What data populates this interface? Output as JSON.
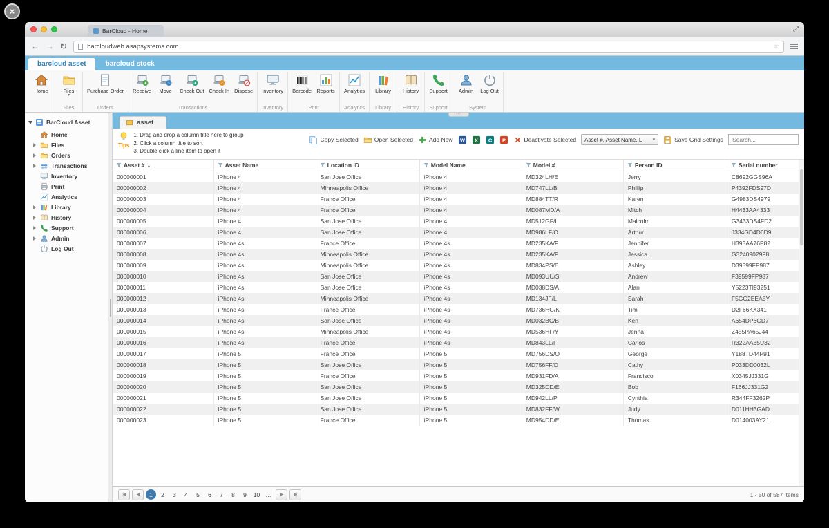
{
  "browser": {
    "tab_title": "BarCloud - Home",
    "url": "barcloudweb.asapsystems.com"
  },
  "app_tabs": [
    {
      "label": "barcloud asset",
      "active": true
    },
    {
      "label": "barcloud stock",
      "active": false
    }
  ],
  "ribbon_groups": [
    {
      "caption": "",
      "buttons": [
        {
          "label": "Home",
          "icon": "home-icon"
        }
      ]
    },
    {
      "caption": "Files",
      "buttons": [
        {
          "label": "Files",
          "icon": "folder-icon",
          "caret": true
        }
      ]
    },
    {
      "caption": "Orders",
      "buttons": [
        {
          "label": "Purchase Order",
          "icon": "purchase-order-icon"
        }
      ]
    },
    {
      "caption": "Transactions",
      "buttons": [
        {
          "label": "Receive",
          "icon": "laptop-receive-icon"
        },
        {
          "label": "Move",
          "icon": "laptop-move-icon"
        },
        {
          "label": "Check Out",
          "icon": "laptop-checkout-icon"
        },
        {
          "label": "Check In",
          "icon": "laptop-checkin-icon"
        },
        {
          "label": "Dispose",
          "icon": "laptop-dispose-icon"
        }
      ]
    },
    {
      "caption": "Inventory",
      "buttons": [
        {
          "label": "Inventory",
          "icon": "monitor-icon"
        }
      ]
    },
    {
      "caption": "Print",
      "buttons": [
        {
          "label": "Barcode",
          "icon": "barcode-icon"
        },
        {
          "label": "Reports",
          "icon": "report-chart-icon"
        }
      ]
    },
    {
      "caption": "Analytics",
      "buttons": [
        {
          "label": "Analytics",
          "icon": "analytics-icon"
        }
      ]
    },
    {
      "caption": "Library",
      "buttons": [
        {
          "label": "Library",
          "icon": "library-icon"
        }
      ]
    },
    {
      "caption": "History",
      "buttons": [
        {
          "label": "History",
          "icon": "history-icon"
        }
      ]
    },
    {
      "caption": "Support",
      "buttons": [
        {
          "label": "Support",
          "icon": "support-icon"
        }
      ]
    },
    {
      "caption": "System",
      "buttons": [
        {
          "label": "Admin",
          "icon": "admin-icon"
        },
        {
          "label": "Log Out",
          "icon": "logout-icon"
        }
      ]
    }
  ],
  "sidebar": {
    "root": "BarCloud Asset",
    "items": [
      {
        "label": "Home",
        "icon": "home-icon",
        "expandable": false
      },
      {
        "label": "Files",
        "icon": "folder-icon",
        "expandable": true
      },
      {
        "label": "Orders",
        "icon": "folder-icon",
        "expandable": true
      },
      {
        "label": "Transactions",
        "icon": "transactions-icon",
        "expandable": true
      },
      {
        "label": "Inventory",
        "icon": "monitor-icon",
        "expandable": false
      },
      {
        "label": "Print",
        "icon": "print-icon",
        "expandable": false
      },
      {
        "label": "Analytics",
        "icon": "analytics-icon",
        "expandable": false
      },
      {
        "label": "Library",
        "icon": "library-icon",
        "expandable": true
      },
      {
        "label": "History",
        "icon": "history-icon",
        "expandable": true
      },
      {
        "label": "Support",
        "icon": "support-icon",
        "expandable": true
      },
      {
        "label": "Admin",
        "icon": "admin-icon",
        "expandable": true
      },
      {
        "label": "Log Out",
        "icon": "logout-icon",
        "expandable": false
      }
    ]
  },
  "content": {
    "tab_label": "asset",
    "tips": {
      "label": "Tips",
      "lines": [
        "1. Drag and drop a column title here to group",
        "2. Click a column title to sort",
        "3. Double click a line item to open it"
      ]
    },
    "actions": {
      "copy": "Copy Selected",
      "open": "Open Selected",
      "add": "Add New",
      "deactivate": "Deactivate Selected",
      "column_select": "Asset #, Asset Name, L",
      "save_grid": "Save Grid Settings",
      "search_placeholder": "Search..."
    },
    "grid": {
      "columns": [
        {
          "label": "Asset #",
          "sorted": "asc"
        },
        {
          "label": "Asset Name"
        },
        {
          "label": "Location ID"
        },
        {
          "label": "Model Name"
        },
        {
          "label": "Model #"
        },
        {
          "label": "Person ID"
        },
        {
          "label": "Serial number"
        }
      ],
      "rows": [
        [
          "000000001",
          "iPhone 4",
          "San Jose Office",
          "iPhone 4",
          "MD324LH/E",
          "Jerry",
          "C8692GGS96A"
        ],
        [
          "000000002",
          "iPhone 4",
          "Minneapolis Office",
          "iPhone 4",
          "MD747LL/B",
          "Phillip",
          "P4392FDS97D"
        ],
        [
          "000000003",
          "iPhone 4",
          "France Office",
          "iPhone 4",
          "MD884TT/R",
          "Karen",
          "G4983DS4979"
        ],
        [
          "000000004",
          "iPhone 4",
          "France Office",
          "iPhone 4",
          "MD087MD/A",
          "Mitch",
          "H4433AA4333"
        ],
        [
          "000000005",
          "iPhone 4",
          "San Jose Office",
          "iPhone 4",
          "MD512GF/I",
          "Malcolm",
          "G3433DS4FD2"
        ],
        [
          "000000006",
          "iPhone 4",
          "San Jose Office",
          "iPhone 4",
          "MD986LF/O",
          "Arthur",
          "J334GD4D6D9"
        ],
        [
          "000000007",
          "iPhone 4s",
          "France Office",
          "iPhone 4s",
          "MD235KA/P",
          "Jennifer",
          "H395AA76P82"
        ],
        [
          "000000008",
          "iPhone 4s",
          "Minneapolis Office",
          "iPhone 4s",
          "MD235KA/P",
          "Jessica",
          "G32409029F8"
        ],
        [
          "000000009",
          "iPhone 4s",
          "Minneapolis Office",
          "iPhone 4s",
          "MD834PS/E",
          "Ashley",
          "D39599FP987"
        ],
        [
          "000000010",
          "iPhone 4s",
          "San Jose Office",
          "iPhone 4s",
          "MD093UU/S",
          "Andrew",
          "F39599FP987"
        ],
        [
          "000000011",
          "iPhone 4s",
          "San Jose Office",
          "iPhone 4s",
          "MD038DS/A",
          "Alan",
          "Y5223TI93251"
        ],
        [
          "000000012",
          "iPhone 4s",
          "Minneapolis Office",
          "iPhone 4s",
          "MD134JF/L",
          "Sarah",
          "F5GG2EEA5Y"
        ],
        [
          "000000013",
          "iPhone 4s",
          "France Office",
          "iPhone 4s",
          "MD736HG/K",
          "Tim",
          "D2F66KX341"
        ],
        [
          "000000014",
          "iPhone 4s",
          "San Jose Office",
          "iPhone 4s",
          "MD032BC/B",
          "Ken",
          "A654DP6GD7"
        ],
        [
          "000000015",
          "iPhone 4s",
          "Minneapolis Office",
          "iPhone 4s",
          "MD536HF/Y",
          "Jenna",
          "Z455PA65J44"
        ],
        [
          "000000016",
          "iPhone 4s",
          "France Office",
          "iPhone 4s",
          "MD843LL/F",
          "Carlos",
          "R322AA35U32"
        ],
        [
          "000000017",
          "iPhone 5",
          "France Office",
          "iPhone 5",
          "MD756DS/O",
          "George",
          "Y188TD44P91"
        ],
        [
          "000000018",
          "iPhone 5",
          "San Jose Office",
          "iPhone 5",
          "MD756FF/D",
          "Cathy",
          "P033DD0032L"
        ],
        [
          "000000019",
          "iPhone 5",
          "France Office",
          "iPhone 5",
          "MD931FD/A",
          "Francisco",
          "X0345JJ331G"
        ],
        [
          "000000020",
          "iPhone 5",
          "San Jose Office",
          "iPhone 5",
          "MD325DD/E",
          "Bob",
          "F166JJ331G2"
        ],
        [
          "000000021",
          "iPhone 5",
          "San Jose Office",
          "iPhone 5",
          "MD942LL/P",
          "Cynthia",
          "R344FF3262P"
        ],
        [
          "000000022",
          "iPhone 5",
          "San Jose Office",
          "iPhone 5",
          "MD832FF/W",
          "Judy",
          "D011HH3GAD"
        ],
        [
          "000000023",
          "iPhone 5",
          "France Office",
          "iPhone 5",
          "MD954DD/E",
          "Thomas",
          "D014003AY21"
        ]
      ]
    },
    "pagination": {
      "pages": [
        "1",
        "2",
        "3",
        "4",
        "5",
        "6",
        "7",
        "8",
        "9",
        "10",
        "…"
      ],
      "current": "1",
      "summary": "1 - 50 of 587 items"
    }
  }
}
